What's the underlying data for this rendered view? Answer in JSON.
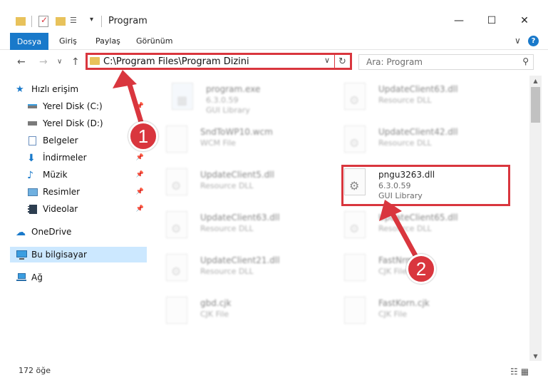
{
  "window": {
    "title": "Program",
    "minimize": "—",
    "maximize": "☐",
    "close": "✕"
  },
  "ribbon": {
    "file_tab": "Dosya",
    "tabs": [
      "Giriş",
      "Paylaş",
      "Görünüm"
    ],
    "expand": "∨",
    "help": "?"
  },
  "address": {
    "path": "C:\\Program Files\\Program Dizini",
    "refresh": "↻",
    "chevron": "∨"
  },
  "search": {
    "placeholder": "Ara: Program",
    "icon": "search-icon"
  },
  "nav": {
    "back": "←",
    "forward": "→",
    "recent": "∨",
    "up": "↑"
  },
  "sidebar": {
    "items": [
      {
        "label": "Hızlı erişim",
        "icon": "star-icon"
      },
      {
        "label": "Yerel Disk (C:)",
        "icon": "drive-icon",
        "pinned": true
      },
      {
        "label": "Yerel Disk (D:)",
        "icon": "drive-icon"
      },
      {
        "label": "Belgeler",
        "icon": "documents-icon"
      },
      {
        "label": "İndirmeler",
        "icon": "download-icon",
        "pinned": true
      },
      {
        "label": "Müzik",
        "icon": "music-icon",
        "pinned": true
      },
      {
        "label": "Resimler",
        "icon": "pictures-icon",
        "pinned": true
      },
      {
        "label": "Videolar",
        "icon": "video-icon",
        "pinned": true
      },
      {
        "label": "OneDrive",
        "icon": "cloud-icon"
      },
      {
        "label": "Bu bilgisayar",
        "icon": "computer-icon",
        "selected": true
      },
      {
        "label": "Ağ",
        "icon": "network-icon"
      }
    ],
    "pin_glyph": "📌"
  },
  "files": [
    {
      "name": "program.exe",
      "sub1": "6.3.0.59",
      "sub2": "GUI Library"
    },
    {
      "name": "UpdateClient63.dll",
      "sub1": "Resource DLL",
      "sub2": ""
    },
    {
      "name": "SndToWP10.wcm",
      "sub1": "WCM File",
      "sub2": ""
    },
    {
      "name": "UpdateClient42.dll",
      "sub1": "Resource DLL",
      "sub2": ""
    },
    {
      "name": "UpdateClient5.dll",
      "sub1": "Resource DLL",
      "sub2": ""
    },
    {
      "name": "pngu3263.dll",
      "sub1": "6.3.0.59",
      "sub2": "GUI Library"
    },
    {
      "name": "UpdateClient63.dll",
      "sub1": "Resource DLL",
      "sub2": ""
    },
    {
      "name": "UpdateClient65.dll",
      "sub1": "Resource DLL",
      "sub2": ""
    },
    {
      "name": "UpdateClient21.dll",
      "sub1": "Resource DLL",
      "sub2": ""
    },
    {
      "name": "FastNrm.cjk",
      "sub1": "CJK File",
      "sub2": ""
    },
    {
      "name": "gbd.cjk",
      "sub1": "CJK File",
      "sub2": ""
    },
    {
      "name": "FastKorn.cjk",
      "sub1": "CJK File",
      "sub2": ""
    }
  ],
  "status": {
    "count": "172 öğe"
  },
  "annotations": {
    "step1": "1",
    "step2": "2"
  },
  "colors": {
    "accent": "#1979ca",
    "annotation_red": "#d9363e",
    "selection": "#cce8ff"
  }
}
